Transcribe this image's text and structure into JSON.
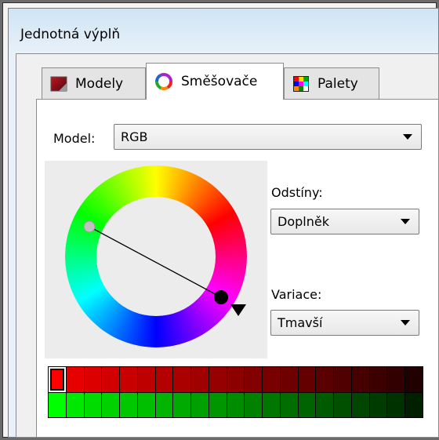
{
  "window": {
    "title": "Jednotná výplň"
  },
  "tabs": [
    {
      "label": "Modely",
      "icon": "models-icon",
      "active": false
    },
    {
      "label": "Směšovače",
      "icon": "mixers-icon",
      "active": true
    },
    {
      "label": "Palety",
      "icon": "palettes-icon",
      "active": false
    }
  ],
  "model": {
    "label": "Model:",
    "value": "RGB"
  },
  "shades": {
    "label": "Odstíny:",
    "value": "Doplněk"
  },
  "variation": {
    "label": "Variace:",
    "value": "Tmavší"
  },
  "swatches": {
    "row1": [
      "#ff0000",
      "#e70000",
      "#dc0000",
      "#d20000",
      "#c80000",
      "#be0000",
      "#b40000",
      "#aa0000",
      "#a00000",
      "#960000",
      "#8c0000",
      "#820000",
      "#780000",
      "#6e0000",
      "#640000",
      "#5a0000",
      "#500000",
      "#460000",
      "#3c0000",
      "#320000",
      "#200000"
    ],
    "row2": [
      "#00ff00",
      "#00e700",
      "#00dc00",
      "#00d200",
      "#00c800",
      "#00be00",
      "#00b400",
      "#00aa00",
      "#00a000",
      "#009600",
      "#008c00",
      "#008200",
      "#007800",
      "#006e00",
      "#006400",
      "#005a00",
      "#005000",
      "#004600",
      "#003c00",
      "#003200",
      "#002000"
    ],
    "selected_index": 0
  },
  "colors": {
    "accent": "#ff0000",
    "complement": "#00ff00"
  }
}
